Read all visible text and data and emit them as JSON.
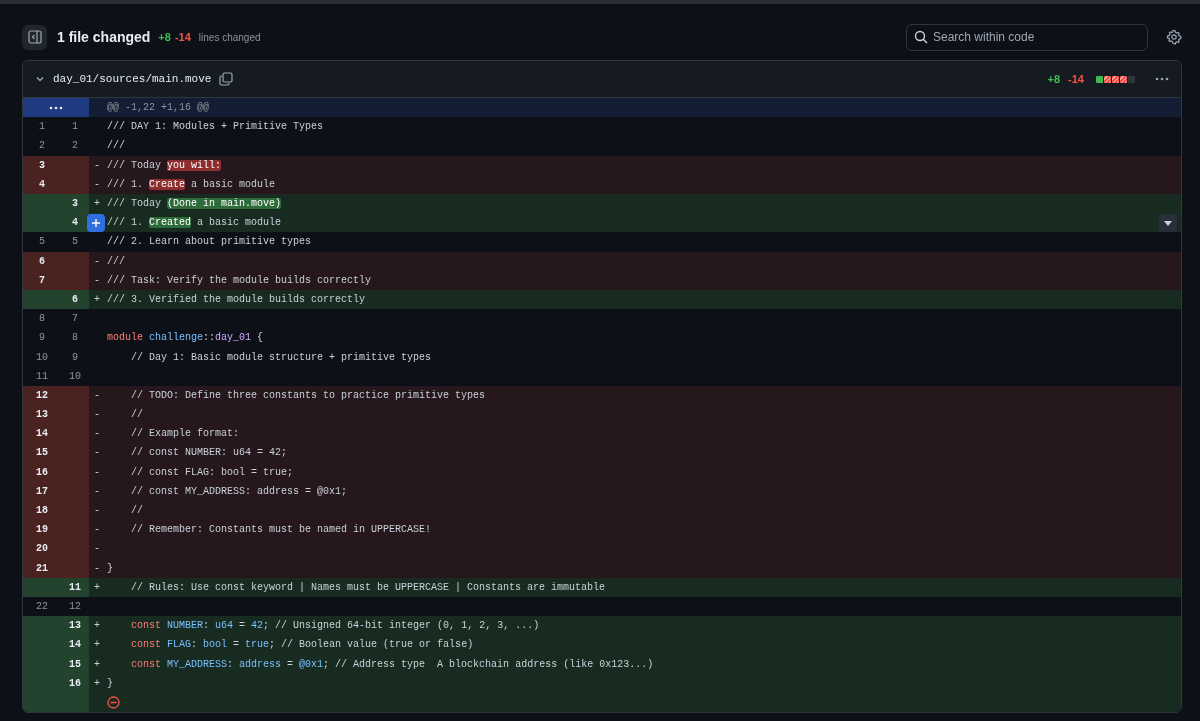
{
  "header": {
    "title": "1 file changed",
    "additions": "+8",
    "deletions": "-14",
    "caption": "lines changed",
    "search": {
      "placeholder": "Search within code"
    }
  },
  "file": {
    "path": "day_01/sources/main.move",
    "additions": "+8",
    "deletions": "-14",
    "diffstat": [
      {
        "kind": "added"
      },
      {
        "kind": "deleted"
      },
      {
        "kind": "deleted"
      },
      {
        "kind": "deleted"
      },
      {
        "kind": "neutral"
      }
    ],
    "rows": [
      {
        "kind": "hunk",
        "hovered": false,
        "code": [
          {
            "text": "@@ -1,22 +1,16 @@",
            "kind": "plain"
          }
        ]
      },
      {
        "kind": "context",
        "old": "1",
        "new": "1",
        "hovered": false,
        "code": [
          {
            "text": "/// DAY 1: Modules + Primitive Types",
            "kind": "plain"
          }
        ]
      },
      {
        "kind": "context",
        "old": "2",
        "new": "2",
        "hovered": false,
        "code": [
          {
            "text": "///",
            "kind": "plain"
          }
        ]
      },
      {
        "kind": "del",
        "old": "3",
        "marker": "-",
        "hovered": false,
        "code": [
          {
            "text": "/// Today ",
            "kind": "plain"
          },
          {
            "text": "you will:",
            "kind": "mark"
          }
        ]
      },
      {
        "kind": "del",
        "old": "4",
        "marker": "-",
        "hovered": false,
        "code": [
          {
            "text": "/// 1. ",
            "kind": "plain"
          },
          {
            "text": "Create",
            "kind": "mark"
          },
          {
            "text": " a basic module",
            "kind": "plain"
          }
        ]
      },
      {
        "kind": "add",
        "new": "3",
        "marker": "+",
        "hovered": false,
        "code": [
          {
            "text": "/// Today ",
            "kind": "plain"
          },
          {
            "text": "(Done in main.move)",
            "kind": "mark"
          }
        ]
      },
      {
        "kind": "add",
        "new": "4",
        "hovered": true,
        "code": [
          {
            "text": "/// 1. ",
            "kind": "plain"
          },
          {
            "text": "Created",
            "kind": "mark"
          },
          {
            "text": " a basic module",
            "kind": "plain"
          }
        ]
      },
      {
        "kind": "context",
        "old": "5",
        "new": "5",
        "hovered": false,
        "code": [
          {
            "text": "/// 2. Learn about primitive types",
            "kind": "plain"
          }
        ]
      },
      {
        "kind": "del",
        "old": "6",
        "marker": "-",
        "hovered": false,
        "code": [
          {
            "text": "///",
            "kind": "plain"
          }
        ]
      },
      {
        "kind": "del",
        "old": "7",
        "marker": "-",
        "hovered": false,
        "code": [
          {
            "text": "/// Task: Verify the module builds correctly",
            "kind": "plain"
          }
        ]
      },
      {
        "kind": "add",
        "new": "6",
        "marker": "+",
        "hovered": false,
        "code": [
          {
            "text": "/// 3. Verified the module builds correctly",
            "kind": "plain"
          }
        ]
      },
      {
        "kind": "context",
        "old": "8",
        "new": "7",
        "hovered": false
      },
      {
        "kind": "context",
        "old": "9",
        "new": "8",
        "hovered": false,
        "code": [
          {
            "text": "module ",
            "kind": "keyword"
          },
          {
            "text": "challenge",
            "kind": "name"
          },
          {
            "text": "::",
            "kind": "plain"
          },
          {
            "text": "day_01",
            "kind": "entity"
          },
          {
            "text": " {",
            "kind": "plain"
          }
        ]
      },
      {
        "kind": "context",
        "old": "10",
        "new": "9",
        "hovered": false,
        "code": [
          {
            "text": "    // Day 1: Basic module structure + primitive types",
            "kind": "plain"
          }
        ]
      },
      {
        "kind": "context",
        "old": "11",
        "new": "10",
        "hovered": false
      },
      {
        "kind": "del",
        "old": "12",
        "marker": "-",
        "hovered": false,
        "code": [
          {
            "text": "    // TODO: Define three constants to practice primitive types",
            "kind": "plain"
          }
        ]
      },
      {
        "kind": "del",
        "old": "13",
        "marker": "-",
        "hovered": false,
        "code": [
          {
            "text": "    //",
            "kind": "plain"
          }
        ]
      },
      {
        "kind": "del",
        "old": "14",
        "marker": "-",
        "hovered": false,
        "code": [
          {
            "text": "    // Example format:",
            "kind": "plain"
          }
        ]
      },
      {
        "kind": "del",
        "old": "15",
        "marker": "-",
        "hovered": false,
        "code": [
          {
            "text": "    // const NUMBER: u64 = 42;",
            "kind": "plain"
          }
        ]
      },
      {
        "kind": "del",
        "old": "16",
        "marker": "-",
        "hovered": false,
        "code": [
          {
            "text": "    // const FLAG: bool = true;",
            "kind": "plain"
          }
        ]
      },
      {
        "kind": "del",
        "old": "17",
        "marker": "-",
        "hovered": false,
        "code": [
          {
            "text": "    // const MY_ADDRESS: address = @0x1;",
            "kind": "plain"
          }
        ]
      },
      {
        "kind": "del",
        "old": "18",
        "marker": "-",
        "hovered": false,
        "code": [
          {
            "text": "    //",
            "kind": "plain"
          }
        ]
      },
      {
        "kind": "del",
        "old": "19",
        "marker": "-",
        "hovered": false,
        "code": [
          {
            "text": "    // Remember: Constants must be named in UPPERCASE!",
            "kind": "plain"
          }
        ]
      },
      {
        "kind": "del",
        "old": "20",
        "marker": "-",
        "hovered": false
      },
      {
        "kind": "del",
        "old": "21",
        "marker": "-",
        "hovered": false,
        "code": [
          {
            "text": "}",
            "kind": "plain"
          }
        ]
      },
      {
        "kind": "add",
        "new": "11",
        "marker": "+",
        "hovered": false,
        "code": [
          {
            "text": "    // Rules: Use const keyword | Names must be UPPERCASE | Constants are immutable",
            "kind": "plain"
          }
        ]
      },
      {
        "kind": "context",
        "old": "22",
        "new": "12",
        "hovered": false
      },
      {
        "kind": "add",
        "new": "13",
        "marker": "+",
        "hovered": false,
        "code": [
          {
            "text": "    const ",
            "kind": "keyword"
          },
          {
            "text": "NUMBER",
            "kind": "name"
          },
          {
            "text": ": ",
            "kind": "plain"
          },
          {
            "text": "u64",
            "kind": "name"
          },
          {
            "text": " = ",
            "kind": "plain"
          },
          {
            "text": "42",
            "kind": "name"
          },
          {
            "text": "; // Unsigned 64-bit integer (0, 1, 2, 3, ...)",
            "kind": "plain"
          }
        ]
      },
      {
        "kind": "add",
        "new": "14",
        "marker": "+",
        "hovered": false,
        "code": [
          {
            "text": "    const ",
            "kind": "keyword"
          },
          {
            "text": "FLAG",
            "kind": "name"
          },
          {
            "text": ": ",
            "kind": "plain"
          },
          {
            "text": "bool",
            "kind": "name"
          },
          {
            "text": " = ",
            "kind": "plain"
          },
          {
            "text": "true",
            "kind": "name"
          },
          {
            "text": "; // Boolean value (true or false)",
            "kind": "plain"
          }
        ]
      },
      {
        "kind": "add",
        "new": "15",
        "marker": "+",
        "hovered": false,
        "code": [
          {
            "text": "    const ",
            "kind": "keyword"
          },
          {
            "text": "MY_ADDRESS",
            "kind": "name"
          },
          {
            "text": ": ",
            "kind": "plain"
          },
          {
            "text": "address",
            "kind": "name"
          },
          {
            "text": " = ",
            "kind": "plain"
          },
          {
            "text": "@0x1",
            "kind": "name"
          },
          {
            "text": "; // Address type  A blockchain address (like 0x123...)",
            "kind": "plain"
          }
        ]
      },
      {
        "kind": "add",
        "new": "16",
        "marker": "+",
        "hovered": false,
        "code": [
          {
            "text": "}",
            "kind": "plain"
          }
        ]
      },
      {
        "kind": "end",
        "hovered": false
      }
    ]
  }
}
